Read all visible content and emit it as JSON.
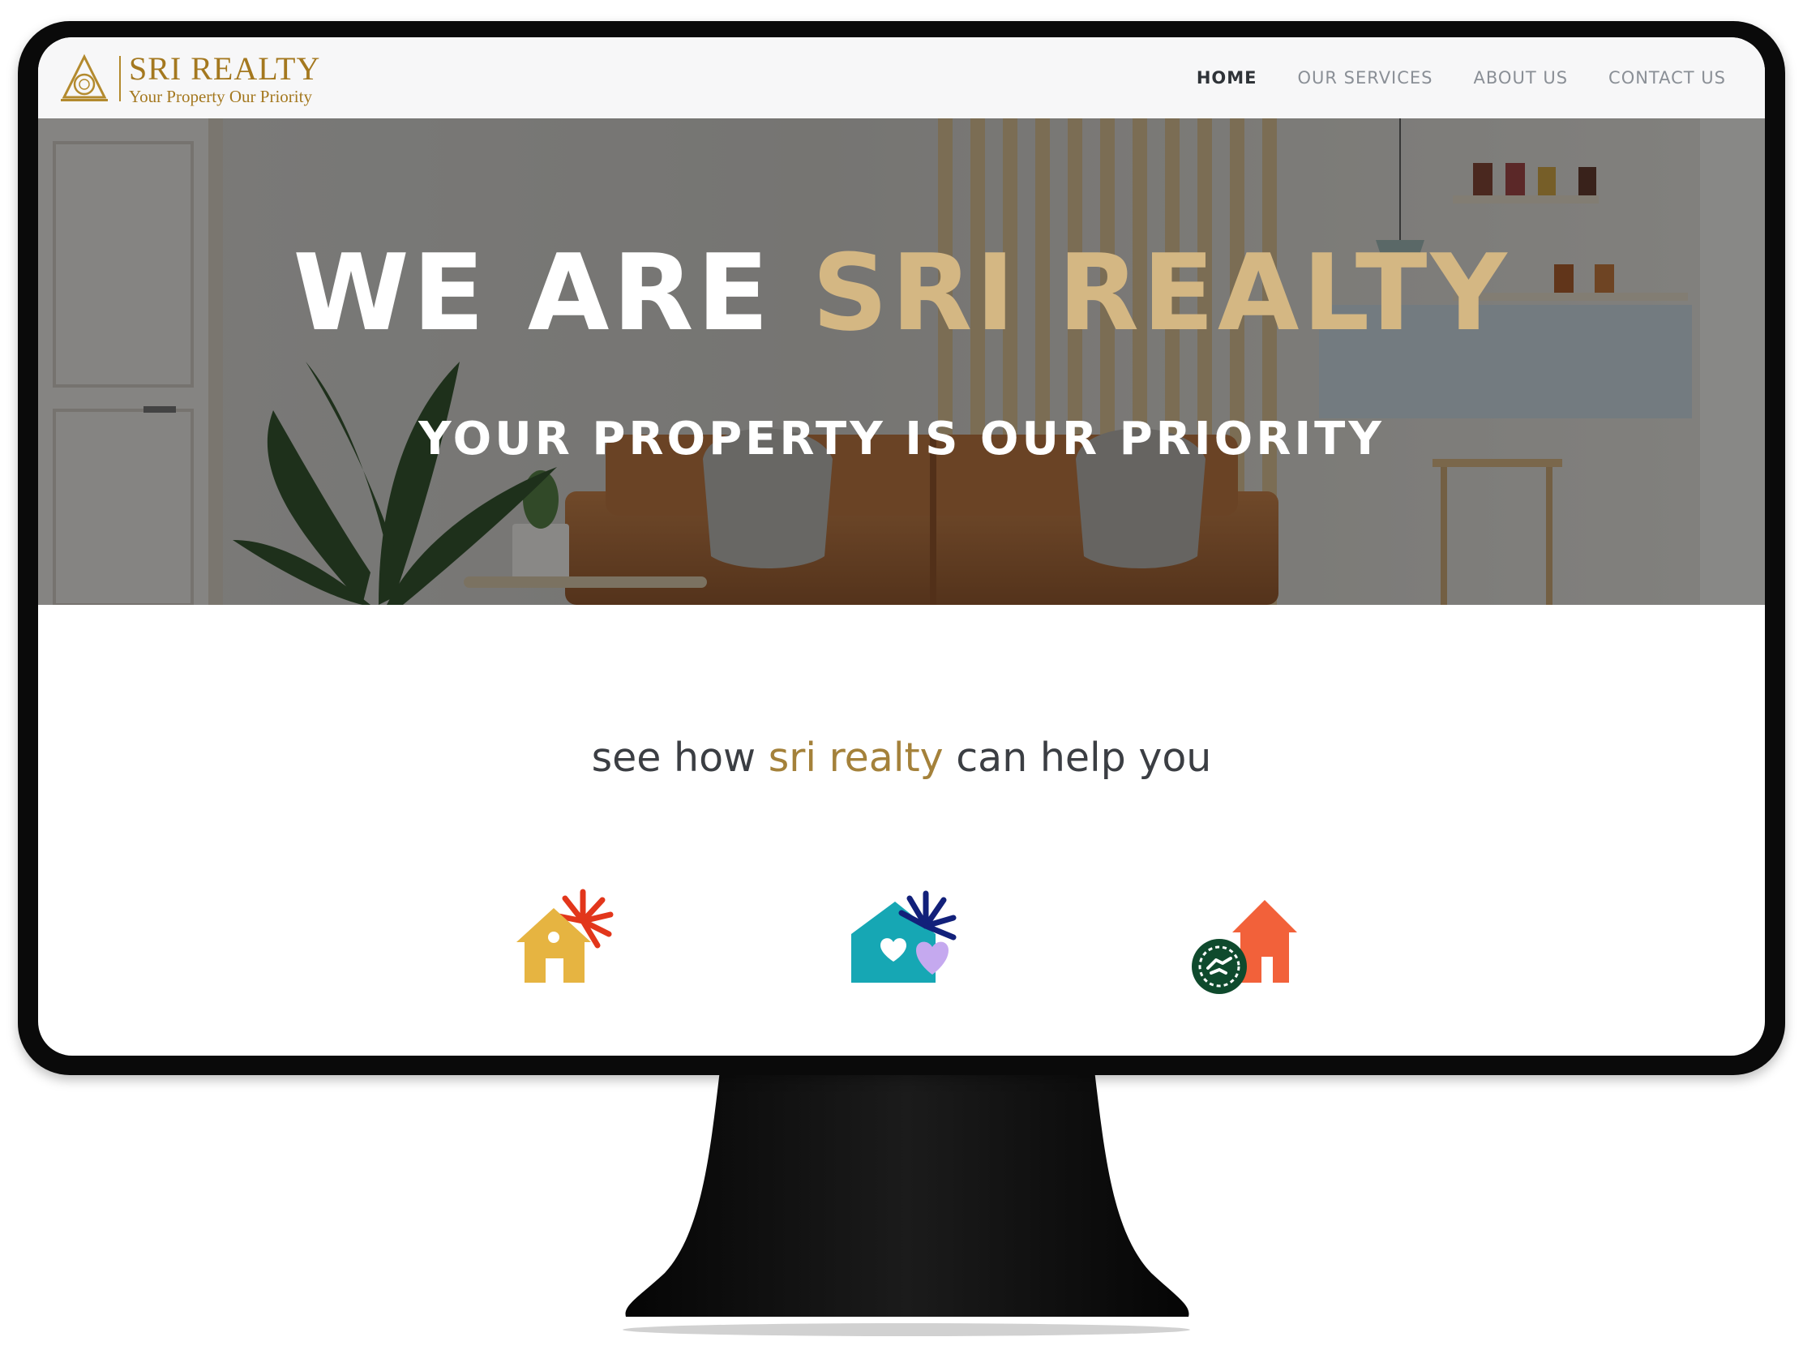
{
  "brand": {
    "name": "SRI REALTY",
    "tagline": "Your Property Our Priority",
    "gold": "#a4781f"
  },
  "nav": {
    "items": [
      {
        "label": "HOME",
        "active": true
      },
      {
        "label": "OUR SERVICES",
        "active": false
      },
      {
        "label": "ABOUT US",
        "active": false
      },
      {
        "label": "CONTACT US",
        "active": false
      }
    ]
  },
  "hero": {
    "title_prefix": "WE ARE ",
    "title_accent": "SRI REALTY",
    "subtitle": "YOUR PROPERTY IS OUR PRIORITY",
    "accent_color": "#d4b783"
  },
  "help": {
    "heading_prefix": "see how ",
    "heading_accent": "sri realty",
    "heading_suffix": " can help you",
    "accent_color": "#a4813a"
  },
  "services": [
    {
      "icon": "house-sunburst-icon"
    },
    {
      "icon": "house-heart-icon"
    },
    {
      "icon": "house-handshake-icon"
    }
  ]
}
